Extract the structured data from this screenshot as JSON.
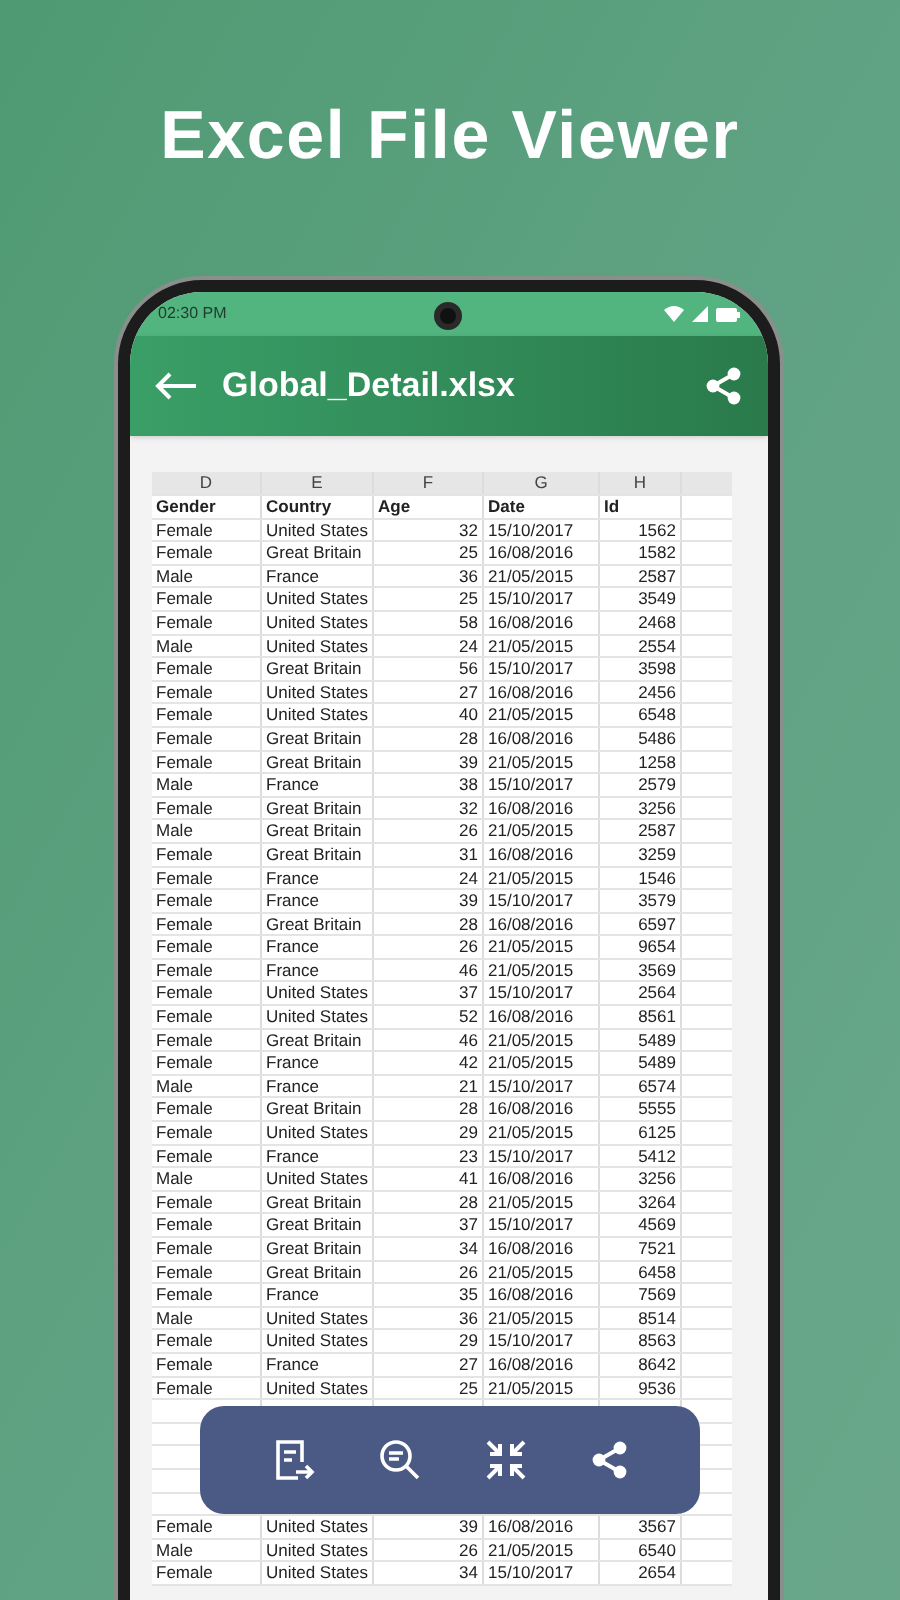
{
  "headline": "Excel File Viewer",
  "status_bar": {
    "time": "02:30 PM"
  },
  "app_bar": {
    "title": "Global_Detail.xlsx"
  },
  "sheet": {
    "column_letters": [
      "D",
      "E",
      "F",
      "G",
      "H"
    ],
    "header_row": [
      "Gender",
      "Country",
      "Age",
      "Date",
      "Id"
    ],
    "rows": [
      [
        "Female",
        "United States",
        "32",
        "15/10/2017",
        "1562"
      ],
      [
        "Female",
        "Great Britain",
        "25",
        "16/08/2016",
        "1582"
      ],
      [
        "Male",
        "France",
        "36",
        "21/05/2015",
        "2587"
      ],
      [
        "Female",
        "United States",
        "25",
        "15/10/2017",
        "3549"
      ],
      [
        "Female",
        "United States",
        "58",
        "16/08/2016",
        "2468"
      ],
      [
        "Male",
        "United States",
        "24",
        "21/05/2015",
        "2554"
      ],
      [
        "Female",
        "Great Britain",
        "56",
        "15/10/2017",
        "3598"
      ],
      [
        "Female",
        "United States",
        "27",
        "16/08/2016",
        "2456"
      ],
      [
        "Female",
        "United States",
        "40",
        "21/05/2015",
        "6548"
      ],
      [
        "Female",
        "Great Britain",
        "28",
        "16/08/2016",
        "5486"
      ],
      [
        "Female",
        "Great Britain",
        "39",
        "21/05/2015",
        "1258"
      ],
      [
        "Male",
        "France",
        "38",
        "15/10/2017",
        "2579"
      ],
      [
        "Female",
        "Great Britain",
        "32",
        "16/08/2016",
        "3256"
      ],
      [
        "Male",
        "Great Britain",
        "26",
        "21/05/2015",
        "2587"
      ],
      [
        "Female",
        "Great Britain",
        "31",
        "16/08/2016",
        "3259"
      ],
      [
        "Female",
        "France",
        "24",
        "21/05/2015",
        "1546"
      ],
      [
        "Female",
        "France",
        "39",
        "15/10/2017",
        "3579"
      ],
      [
        "Female",
        "Great Britain",
        "28",
        "16/08/2016",
        "6597"
      ],
      [
        "Female",
        "France",
        "26",
        "21/05/2015",
        "9654"
      ],
      [
        "Female",
        "France",
        "46",
        "21/05/2015",
        "3569"
      ],
      [
        "Female",
        "United States",
        "37",
        "15/10/2017",
        "2564"
      ],
      [
        "Female",
        "United States",
        "52",
        "16/08/2016",
        "8561"
      ],
      [
        "Female",
        "Great Britain",
        "46",
        "21/05/2015",
        "5489"
      ],
      [
        "Female",
        "France",
        "42",
        "21/05/2015",
        "5489"
      ],
      [
        "Male",
        "France",
        "21",
        "15/10/2017",
        "6574"
      ],
      [
        "Female",
        "Great Britain",
        "28",
        "16/08/2016",
        "5555"
      ],
      [
        "Female",
        "United States",
        "29",
        "21/05/2015",
        "6125"
      ],
      [
        "Female",
        "France",
        "23",
        "15/10/2017",
        "5412"
      ],
      [
        "Male",
        "United States",
        "41",
        "16/08/2016",
        "3256"
      ],
      [
        "Female",
        "Great Britain",
        "28",
        "21/05/2015",
        "3264"
      ],
      [
        "Female",
        "Great Britain",
        "37",
        "15/10/2017",
        "4569"
      ],
      [
        "Female",
        "Great Britain",
        "34",
        "16/08/2016",
        "7521"
      ],
      [
        "Female",
        "Great Britain",
        "26",
        "21/05/2015",
        "6458"
      ],
      [
        "Female",
        "France",
        "35",
        "16/08/2016",
        "7569"
      ],
      [
        "Male",
        "United States",
        "36",
        "21/05/2015",
        "8514"
      ],
      [
        "Female",
        "United States",
        "29",
        "15/10/2017",
        "8563"
      ],
      [
        "Female",
        "France",
        "27",
        "16/08/2016",
        "8642"
      ],
      [
        "Female",
        "United States",
        "25",
        "21/05/2015",
        "9536"
      ]
    ],
    "rows_below_toolbar": [
      [
        "Female",
        "United States",
        "39",
        "16/08/2016",
        "3567"
      ],
      [
        "Male",
        "United States",
        "26",
        "21/05/2015",
        "6540"
      ],
      [
        "Female",
        "United States",
        "34",
        "15/10/2017",
        "2654"
      ]
    ]
  }
}
